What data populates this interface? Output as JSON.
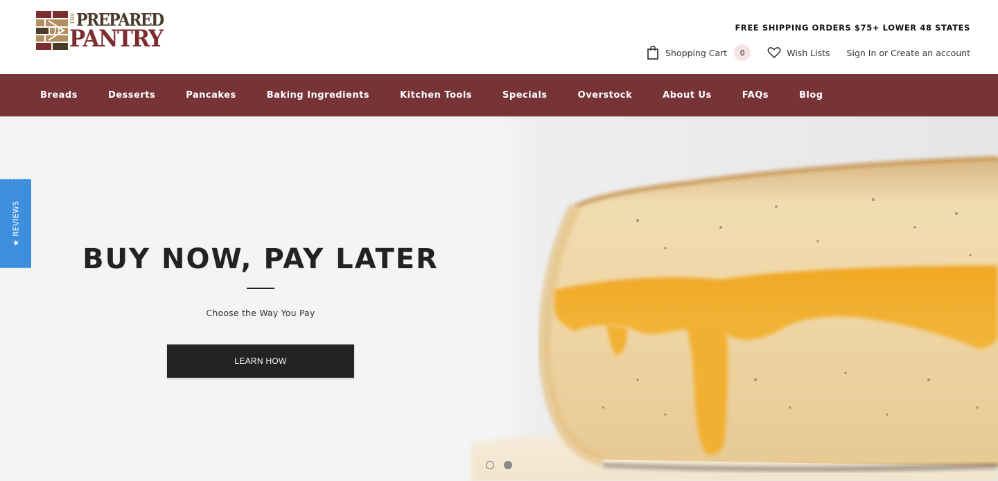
{
  "header": {
    "logo": {
      "the": "THE",
      "line1": "PREPARED",
      "line2": "PANTRY",
      "colors": {
        "maroon": "#7b2d30",
        "brown": "#4a3a2a",
        "tan": "#b28f5e"
      }
    },
    "promo": "FREE SHIPPING ORDERS $75+ LOWER 48 STATES",
    "cart": {
      "icon": "shopping-bag-icon",
      "label": "Shopping Cart",
      "count": "0"
    },
    "wishlist": {
      "icon": "heart-icon",
      "label": "Wish Lists"
    },
    "account": {
      "sign_in": "Sign In",
      "or": " or ",
      "create": "Create an account"
    }
  },
  "nav": {
    "background": "#773436",
    "items": [
      {
        "label": "Breads"
      },
      {
        "label": "Desserts"
      },
      {
        "label": "Pancakes"
      },
      {
        "label": "Baking Ingredients"
      },
      {
        "label": "Kitchen Tools"
      },
      {
        "label": "Specials"
      },
      {
        "label": "Overstock"
      },
      {
        "label": "About Us"
      },
      {
        "label": "FAQs"
      },
      {
        "label": "Blog"
      }
    ]
  },
  "hero": {
    "title": "BUY NOW, PAY LATER",
    "subtitle": "Choose the Way You Pay",
    "button": "LEARN HOW",
    "image": "grilled-cheese-sandwich",
    "slides": {
      "count": 2,
      "active": 2
    }
  },
  "reviews_tab": {
    "icon": "star-icon",
    "label": "REVIEWS",
    "color": "#3d8fdd"
  }
}
